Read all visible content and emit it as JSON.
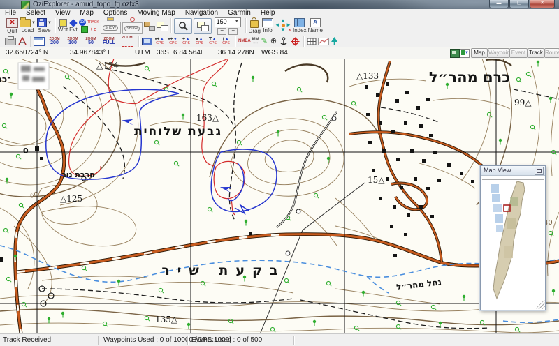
{
  "window": {
    "title": "OziExplorer - amud_topo_fg.ozfx3"
  },
  "menu": {
    "items": [
      "File",
      "Select",
      "View",
      "Map",
      "Options",
      "Moving Map",
      "Navigation",
      "Garmin",
      "Help"
    ]
  },
  "toolbar": {
    "quit": "Quit",
    "load": "Load",
    "save": "Save",
    "wpt": "Wpt",
    "evt": "Evt",
    "track_label": "TRACK",
    "show": "SHOW",
    "zoom_level": "150",
    "drag": "Drag",
    "info": "Info",
    "index": "Index",
    "name": "Name",
    "zoom_top": "ZOOM",
    "zoom_200": "200",
    "zoom_100": "100",
    "zoom_50": "50",
    "zoom_full": "FULL",
    "gps": "GPS",
    "nmea": "NMEA",
    "mm": "MM"
  },
  "coordbar": {
    "latitude": "32.650724° N",
    "longitude": "34.967843° E",
    "utm_label": "UTM",
    "utm_zone": "36S",
    "easting": "6 84 564E",
    "northing": "36 14 278N",
    "datum": "WGS 84",
    "map_btn": "Map",
    "waypoint_btn": "Waypoint",
    "event_btn": "Event",
    "track_btn": "Track",
    "route_btn": "Route"
  },
  "map": {
    "labels": {
      "givat": "גבעת שלוחית",
      "kerem": "כרם מהר״ל",
      "hurbat": "חרבת נור",
      "bikat": "בקעת שיר",
      "nahal": "נחל מהר״ל",
      "edge_partial": "־כת"
    },
    "spots": {
      "s124": "△124",
      "s163": "163△",
      "s133": "△133",
      "s99": "99△",
      "s125": "△125",
      "s15": "15△",
      "s135": "135△"
    },
    "contour_labels": {
      "c60": "60",
      "c40": "40",
      "grid0": "0"
    },
    "colors": {
      "track_blue": "#2636cf",
      "track_red": "#d42a2a",
      "road_orange": "#c75b1e",
      "veg_green": "#2fae2f",
      "water_blue": "#4a8ede"
    }
  },
  "map_view": {
    "title": "Map View"
  },
  "statusbar": {
    "track": "Track Received",
    "waypoints": "Waypoints Used : 0 of 10000  (GPS:1000)",
    "events": "Events Used : 0 of 500"
  }
}
